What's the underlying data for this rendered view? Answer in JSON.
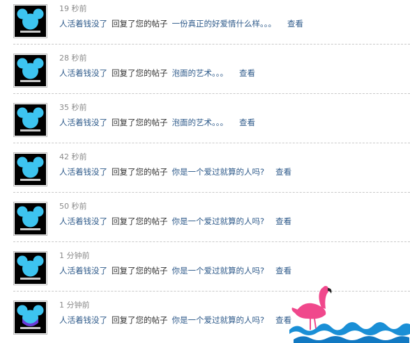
{
  "feed": {
    "items": [
      {
        "time": "19 秒前",
        "user": "人活着钱没了",
        "action": "回复了您的帖子",
        "post": "一份真正的好爱情什么样。。。",
        "view": "查看"
      },
      {
        "time": "28 秒前",
        "user": "人活着钱没了",
        "action": "回复了您的帖子",
        "post": "泡面的艺术。。。",
        "view": "查看"
      },
      {
        "time": "35 秒前",
        "user": "人活着钱没了",
        "action": "回复了您的帖子",
        "post": "泡面的艺术。。。",
        "view": "查看"
      },
      {
        "time": "42 秒前",
        "user": "人活着钱没了",
        "action": "回复了您的帖子",
        "post": "你是一个爱过就算的人吗?",
        "view": "查看"
      },
      {
        "time": "50 秒前",
        "user": "人活着钱没了",
        "action": "回复了您的帖子",
        "post": "你是一个爱过就算的人吗?",
        "view": "查看"
      },
      {
        "time": "1 分钟前",
        "user": "人活着钱没了",
        "action": "回复了您的帖子",
        "post": "你是一个爱过就算的人吗?",
        "view": "查看"
      },
      {
        "time": "1 分钟前",
        "user": "人活着钱没了",
        "action": "回复了您的帖子",
        "post": "你是一个爱过就算的人吗?",
        "view": "查看"
      }
    ]
  },
  "avatar_icon": "mickey-ears-icon",
  "decoration_icon": "flamingo-waves-icon",
  "colors": {
    "link": "#2e5a8a",
    "muted": "#8a8a8a",
    "avatar_blue": "#3dc4f0",
    "flamingo": "#f0488c",
    "wave": "#1a8fd6"
  }
}
